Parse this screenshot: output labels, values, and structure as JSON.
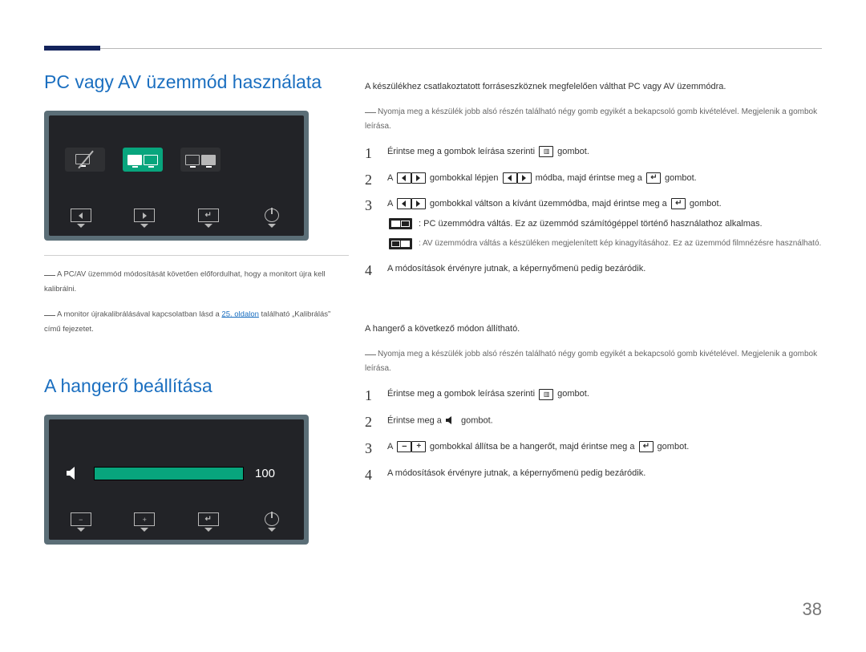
{
  "page_number": "38",
  "section1": {
    "title": "PC vagy AV üzemmód használata",
    "note1": "A PC/AV üzemmód módosítását követően előfordulhat, hogy a monitort újra kell kalibrálni.",
    "note2_pre": "A monitor újrakalibrálásával kapcsolatban lásd a ",
    "note2_link": "25. oldalon",
    "note2_post": " található „Kalibrálás” című fejezetet.",
    "intro": "A készülékhez csatlakoztatott forráseszköznek megfelelően válthat PC vagy AV üzemmódra.",
    "subnote": "Nyomja meg a készülék jobb alsó részén található négy gomb egyikét a bekapcsoló gomb kivételével. Megjelenik a gombok leírása.",
    "step1_a": "Érintse meg a gombok leírása szerinti ",
    "step1_b": " gombot.",
    "step2_a": "A ",
    "step2_b": " gombokkal lépjen ",
    "step2_c": " módba, majd érintse meg a ",
    "step2_d": " gombot.",
    "step3_a": "A ",
    "step3_b": " gombokkal váltson a kívánt üzemmódba, majd érintse meg a ",
    "step3_c": " gombot.",
    "explA": ": PC üzemmódra váltás. Ez az üzemmód számítógéppel történő használathoz alkalmas.",
    "explB": ": AV üzemmódra váltás a készüléken megjelenített kép kinagyításához. Ez az üzemmód filmnézésre használható.",
    "step4": "A módosítások érvényre jutnak, a képernyőmenü pedig bezáródik."
  },
  "section2": {
    "title": "A hangerő beállítása",
    "vol_value": "100",
    "intro": "A hangerő a következő módon állítható.",
    "subnote": "Nyomja meg a készülék jobb alsó részén található négy gomb egyikét a bekapcsoló gomb kivételével. Megjelenik a gombok leírása.",
    "step1_a": "Érintse meg a gombok leírása szerinti ",
    "step1_b": " gombot.",
    "step2_a": "Érintse meg a ",
    "step2_b": " gombot.",
    "step3_a": "A ",
    "step3_b": " gombokkal állítsa be a hangerőt, majd érintse meg a ",
    "step3_c": " gombot.",
    "step4": "A módosítások érvényre jutnak, a képernyőmenü pedig bezáródik."
  }
}
